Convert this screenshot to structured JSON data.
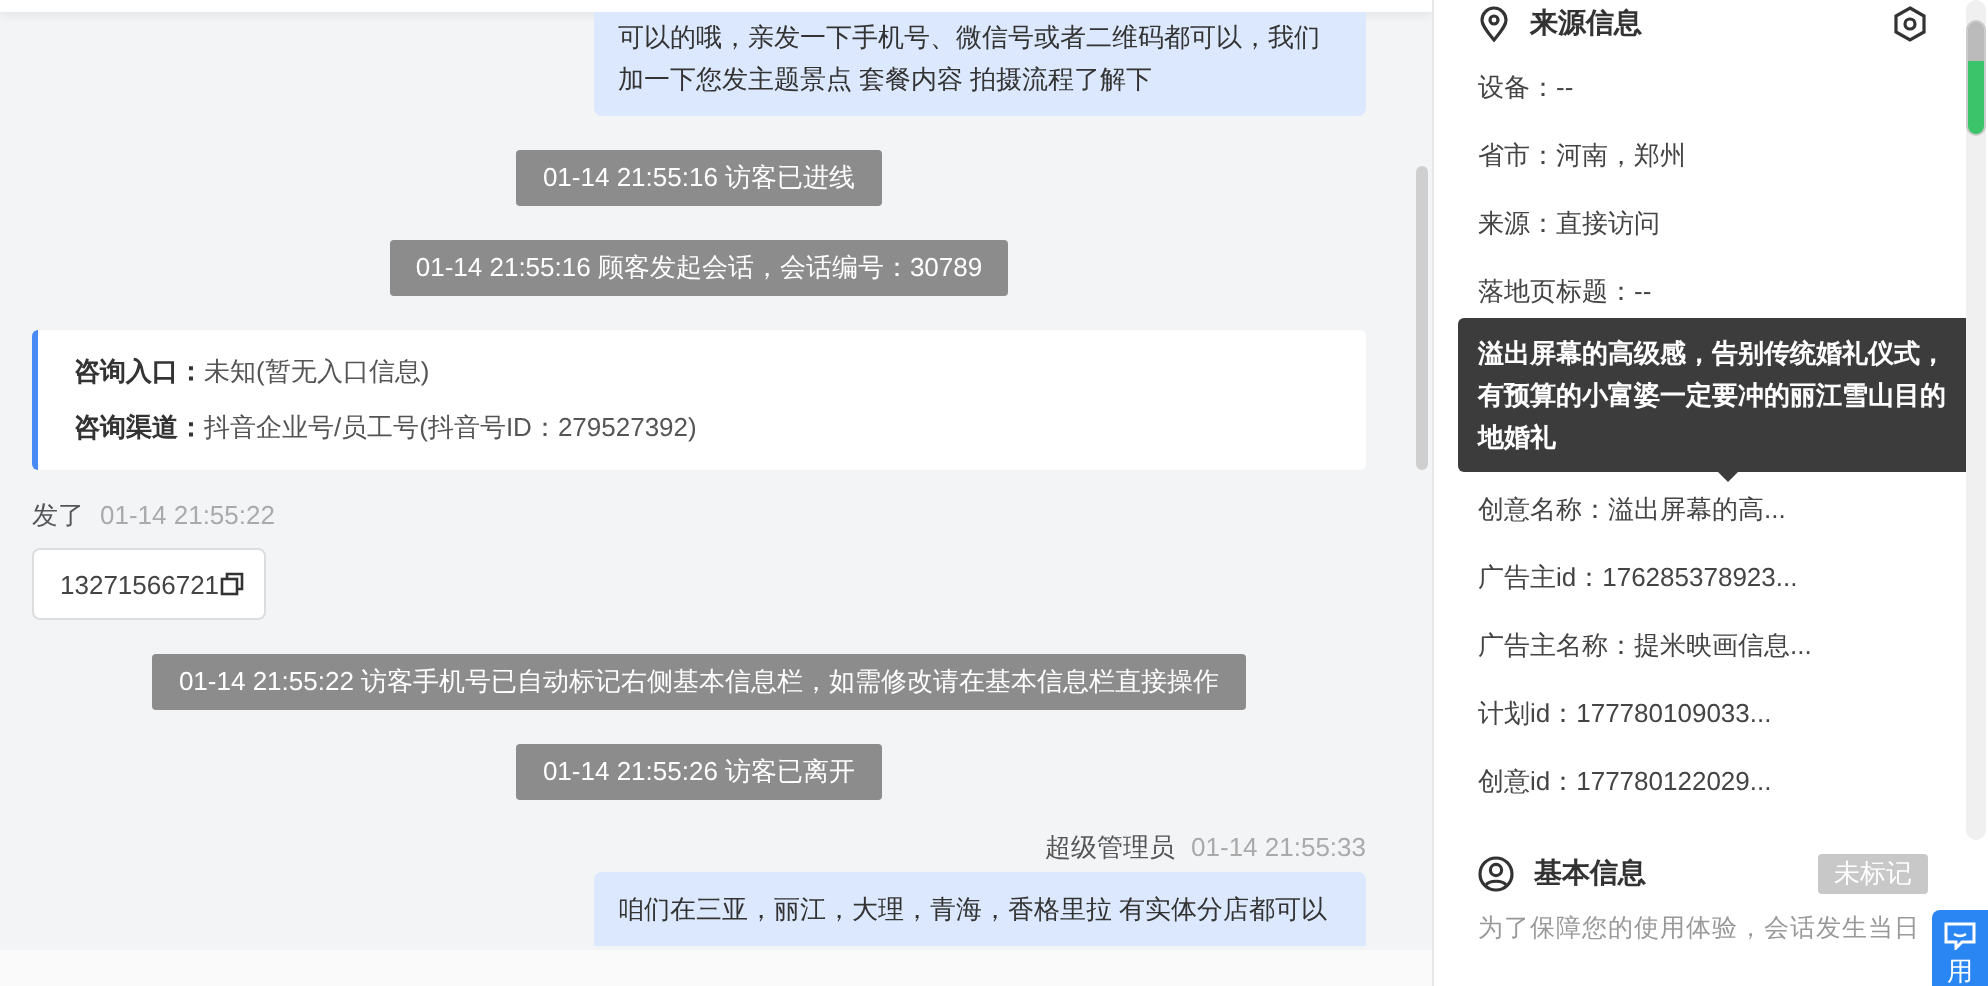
{
  "chat": {
    "messages": [
      {
        "kind": "agent",
        "text": "可以的哦，亲发一下手机号、微信号或者二维码都可以，我们加一下您发主题景点 套餐内容 拍摄流程了解下"
      },
      {
        "kind": "system",
        "text": "01-14 21:55:16 访客已进线"
      },
      {
        "kind": "system",
        "text": "01-14 21:55:16 顾客发起会话，会话编号：30789"
      },
      {
        "kind": "info_card",
        "rows": [
          {
            "label": "咨询入口：",
            "value": "未知(暂无入口信息)"
          },
          {
            "label": "咨询渠道：",
            "value": "抖音企业号/员工号(抖音号ID：279527392)"
          }
        ]
      },
      {
        "kind": "visitor",
        "sender": "发了",
        "time": "01-14 21:55:22"
      },
      {
        "kind": "phone",
        "text": "13271566721"
      },
      {
        "kind": "system",
        "text": "01-14 21:55:22 访客手机号已自动标记右侧基本信息栏，如需修改请在基本信息栏直接操作"
      },
      {
        "kind": "system",
        "text": "01-14 21:55:26 访客已离开"
      },
      {
        "kind": "agent_header",
        "sender": "超级管理员",
        "time": "01-14 21:55:33"
      },
      {
        "kind": "agent",
        "text": "咱们在三亚，丽江，大理，青海，香格里拉 有实体分店都可以"
      }
    ]
  },
  "source_info": {
    "title": "来源信息",
    "rows": [
      {
        "kind": "field",
        "text": "设备：--"
      },
      {
        "kind": "field",
        "text": "省市：河南，郑州"
      },
      {
        "kind": "field",
        "text": "来源：直接访问"
      },
      {
        "kind": "field",
        "text": "落地页标题：--"
      },
      {
        "kind": "tooltip",
        "text": "溢出屏幕的高级感，告别传统婚礼仪式，有预算的小富婆一定要冲的丽江雪山目的地婚礼"
      },
      {
        "kind": "field",
        "text": "创意名称：溢出屏幕的高..."
      },
      {
        "kind": "field",
        "text": "广告主id：176285378923..."
      },
      {
        "kind": "field",
        "text": "广告主名称：提米映画信息..."
      },
      {
        "kind": "field",
        "text": "计划id：177780109033..."
      },
      {
        "kind": "field",
        "text": "创意id：177780122029..."
      }
    ]
  },
  "basic_info": {
    "title": "基本信息",
    "tag": "未标记",
    "notice": "为了保障您的使用体验，会话发生当日"
  },
  "float_button": {
    "label": "用"
  }
}
